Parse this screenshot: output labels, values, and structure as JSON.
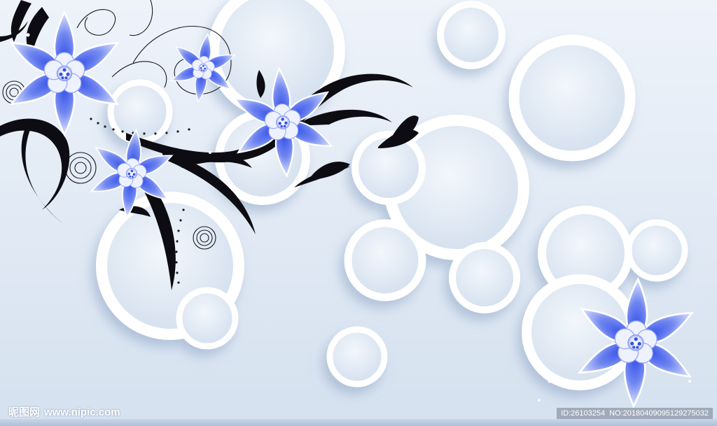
{
  "watermark": {
    "brand": "昵图网",
    "site": "www.nipic.com",
    "id_label": "ID:26103254",
    "no_label": "NO:20180409095129275032"
  },
  "colors": {
    "background_top": "#eef3fa",
    "background_bottom": "#d5e1ef",
    "ring": "#ffffff",
    "ring_shadow": "#9fb3cf",
    "petal_blue": "#2f4fe0",
    "petal_light": "#e9efff",
    "vine": "#0c0c12"
  },
  "scene": {
    "rings": 16,
    "flowers": 5,
    "description_icons": [
      "ring-icon",
      "flower-icon",
      "vine-icon",
      "swirl-icon"
    ]
  }
}
